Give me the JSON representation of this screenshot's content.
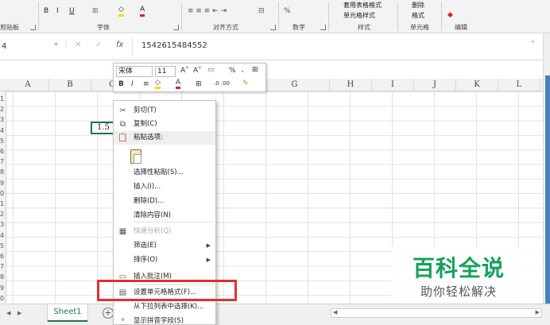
{
  "ribbon": {
    "groups": {
      "clipboard": "剪贴板",
      "font": "字体",
      "alignment": "对齐方式",
      "number": "数字",
      "styles": "样式",
      "cells": "单元格",
      "editing": "编辑"
    },
    "buttons": {
      "bold": "B",
      "italic": "I",
      "underline": "U",
      "format_as_table": "套用表格格式",
      "cell_styles": "单元格样式",
      "format": "格式",
      "delete": "删除",
      "percent": "%"
    }
  },
  "formula_bar": {
    "name_box": "4",
    "fx": "fx",
    "value": "1542615484552"
  },
  "columns": [
    "A",
    "B",
    "C",
    "D",
    "E",
    "F",
    "G",
    "H",
    "I",
    "J",
    "K",
    "L"
  ],
  "rows": [
    "1",
    "2",
    "3",
    "4",
    "5",
    "6",
    "7",
    "8",
    "9",
    "0",
    "1",
    "2",
    "3",
    "4",
    "5",
    "6",
    "7",
    "8",
    "9",
    "0"
  ],
  "active_cell_text": "1.5",
  "mini_toolbar": {
    "font_name": "宋体",
    "font_size": "11",
    "bold": "B",
    "italic": "I",
    "percent": "%",
    "comma": ","
  },
  "context_menu": {
    "items": [
      {
        "label": "剪切(T)",
        "icon": "scissors-icon",
        "disabled": false
      },
      {
        "label": "复制(C)",
        "icon": "copy-icon",
        "disabled": false
      },
      {
        "label": "粘贴选项:",
        "icon": "paste-icon",
        "disabled": false
      },
      {
        "label": "选择性粘贴(S)...",
        "disabled": false
      },
      {
        "label": "插入(I)...",
        "disabled": false
      },
      {
        "label": "删除(D)...",
        "disabled": false
      },
      {
        "label": "清除内容(N)",
        "disabled": false
      },
      {
        "label": "快速分析(Q)",
        "icon": "quick-analysis-icon",
        "disabled": true
      },
      {
        "label": "筛选(E)",
        "disabled": false,
        "submenu": true
      },
      {
        "label": "排序(O)",
        "disabled": false,
        "submenu": true
      },
      {
        "label": "插入批注(M)",
        "icon": "comment-icon",
        "disabled": false
      },
      {
        "label": "设置单元格格式(F)...",
        "icon": "format-cells-icon",
        "disabled": false
      },
      {
        "label": "从下拉列表中选择(K)...",
        "disabled": false
      },
      {
        "label": "显示拼音字段(S)",
        "icon": "phonetic-icon",
        "disabled": false
      }
    ]
  },
  "sheet_bar": {
    "tab": "Sheet1",
    "add": "+"
  },
  "watermark": {
    "main": "百科全说",
    "sub": "助你轻松解决"
  },
  "colors": {
    "excel_green": "#217346",
    "highlight_red": "#e03030",
    "watermark_green": "#16a05a"
  }
}
